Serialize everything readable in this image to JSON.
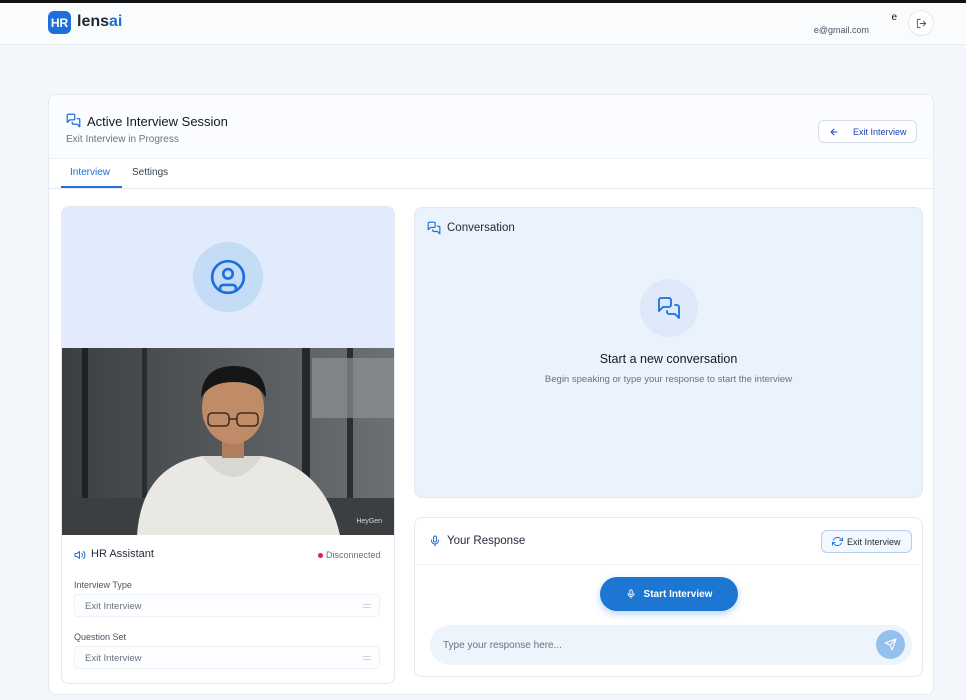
{
  "app": {
    "logo_badge": "HR",
    "logo_name_part1": "lens",
    "logo_name_part2": "ai",
    "brand_color": "#1e6fd9"
  },
  "user": {
    "name": "e",
    "email": "e@gmail.com"
  },
  "session": {
    "title": "Active Interview Session",
    "subtitle": "Exit Interview in Progress",
    "exit_button_label": "Exit Interview"
  },
  "tabs": [
    {
      "label": "Interview",
      "active": true
    },
    {
      "label": "Settings",
      "active": false
    }
  ],
  "assistant": {
    "name": "HR Assistant",
    "status": "Disconnected",
    "status_color": "#e11d48",
    "video_watermark": "HeyGen",
    "fields": [
      {
        "label": "Interview Type",
        "value": "Exit Interview"
      },
      {
        "label": "Question Set",
        "value": "Exit Interview"
      }
    ]
  },
  "conversation": {
    "title": "Conversation",
    "empty_title": "Start a new conversation",
    "empty_subtitle": "Begin speaking or type your response to start the interview"
  },
  "response": {
    "title": "Your Response",
    "mode_button_label": "Exit Interview",
    "start_button_label": "Start Interview",
    "input_placeholder": "Type your response here..."
  }
}
